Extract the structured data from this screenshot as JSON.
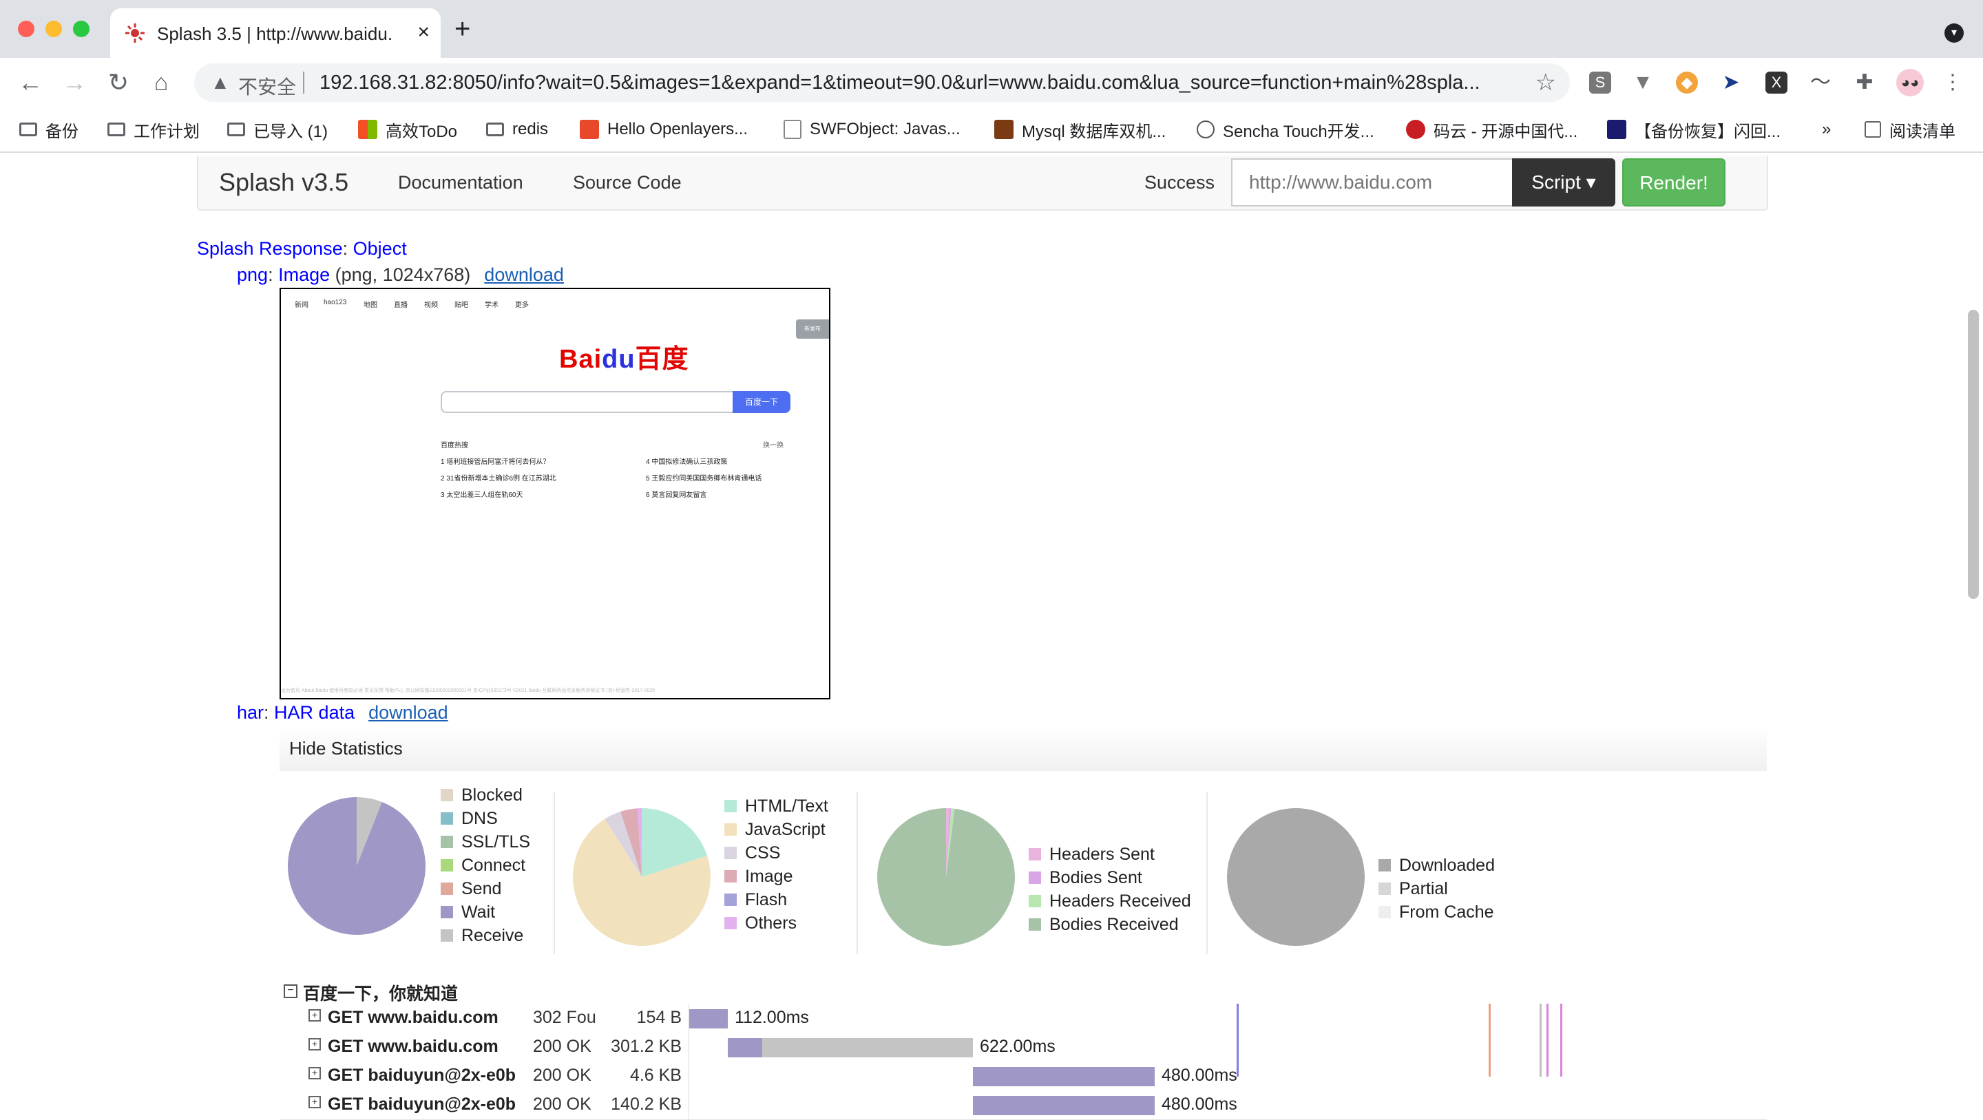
{
  "browser": {
    "tab_title": "Splash 3.5 | http://www.baidu.c",
    "tab_close": "×",
    "new_tab": "+",
    "insecure_label": "不安全",
    "url": "192.168.31.82:8050/info?wait=0.5&images=1&expand=1&timeout=90.0&url=www.baidu.com&lua_source=function+main%28spla...",
    "bookmarks": [
      "备份",
      "工作计划",
      "已导入 (1)",
      "高效ToDo",
      "redis",
      "Hello Openlayers...",
      "SWFObject: Javas...",
      "Mysql 数据库双机...",
      "Sencha Touch开发...",
      "码云 - 开源中国代...",
      "【备份恢复】闪回...",
      "»",
      "阅读清单"
    ]
  },
  "splash": {
    "brand": "Splash v3.5",
    "nav": [
      "Documentation",
      "Source Code"
    ],
    "status": "Success",
    "url_input": "http://www.baidu.com",
    "script_label": "Script ▾",
    "render_label": "Render!"
  },
  "response": {
    "root_key": "Splash Response",
    "root_type": "Object",
    "png_key": "png",
    "png_type": "Image",
    "png_info": "(png, 1024x768)",
    "png_download": "download",
    "har_key": "har",
    "har_type": "HAR data",
    "har_download": "download"
  },
  "preview": {
    "nav": [
      "新闻",
      "hao123",
      "地图",
      "直播",
      "视频",
      "贴吧",
      "学术",
      "更多"
    ],
    "logo_a": "Bai",
    "logo_b": "du",
    "logo_c": "百度",
    "search_btn": "百度一下",
    "hot_title": "百度热搜",
    "hot_refresh": "换一换",
    "hot_left": [
      "1  塔利班接管后阿富汗将何去何从？",
      "2  31省份新增本土确诊6例 在江苏湖北",
      "3  太空出差三人组在轨60天"
    ],
    "hot_right": [
      "4  中国拟修法确认三孩政策",
      "5  王毅应约同美国国务卿布林肯通电话",
      "6  莫言回复网友留言"
    ],
    "login": "新发布",
    "footer": "设为首页    About Baidu    使用百度前必读    意见反馈    帮助中心    京公网安备11000002000001号    京ICP证030173号    ©2021 Baidu    互联网药品信息服务资格证书 (京)-经营性-2017-0020"
  },
  "har": {
    "toggle_label": "Hide Statistics",
    "legend_timing": [
      {
        "label": "Blocked",
        "color": "#e2d6c4"
      },
      {
        "label": "DNS",
        "color": "#85bec8"
      },
      {
        "label": "SSL/TLS",
        "color": "#a7c3a7"
      },
      {
        "label": "Connect",
        "color": "#a9d97a"
      },
      {
        "label": "Send",
        "color": "#e0a89a"
      },
      {
        "label": "Wait",
        "color": "#9f97c5"
      },
      {
        "label": "Receive",
        "color": "#c4c4c4"
      }
    ],
    "legend_type": [
      {
        "label": "HTML/Text",
        "color": "#b5e9d8"
      },
      {
        "label": "JavaScript",
        "color": "#f1e2bd"
      },
      {
        "label": "CSS",
        "color": "#dad4e1"
      },
      {
        "label": "Image",
        "color": "#dcabb4"
      },
      {
        "label": "Flash",
        "color": "#a5a2da"
      },
      {
        "label": "Others",
        "color": "#e3b2ee"
      }
    ],
    "legend_traffic": [
      {
        "label": "Headers Sent",
        "color": "#e8b3dc"
      },
      {
        "label": "Bodies Sent",
        "color": "#d8a6e6"
      },
      {
        "label": "Headers Received",
        "color": "#b7e6b1"
      },
      {
        "label": "Bodies Received",
        "color": "#a7c3a7"
      }
    ],
    "legend_cache": [
      {
        "label": "Downloaded",
        "color": "#a9a9a9"
      },
      {
        "label": "Partial",
        "color": "#d7d7d7"
      },
      {
        "label": "From Cache",
        "color": "#eeeeee"
      }
    ],
    "pie_timing": [
      0.94,
      0.06
    ],
    "pie_type": [
      {
        "v": 0.2,
        "c": "#b5e9d8"
      },
      {
        "v": 0.71,
        "c": "#f1e2bd"
      },
      {
        "v": 0.04,
        "c": "#dad4e1"
      },
      {
        "v": 0.04,
        "c": "#dcabb4"
      },
      {
        "v": 0.01,
        "c": "#e3b2ee"
      }
    ],
    "pie_traffic": [
      {
        "v": 0.008,
        "c": "#e8b3dc"
      },
      {
        "v": 0.004,
        "c": "#d8a6e6"
      },
      {
        "v": 0.008,
        "c": "#b7e6b1"
      },
      {
        "v": 0.98,
        "c": "#a7c3a7"
      }
    ],
    "page_title": "百度一下，你就知道",
    "requests": [
      {
        "name": "GET www.baidu.com",
        "status": "302 Fou",
        "size": "154 B",
        "time": "112.00ms",
        "wait_start": 0,
        "wait_len": 56,
        "recv_len": 0
      },
      {
        "name": "GET www.baidu.com",
        "status": "200 OK",
        "size": "301.2 KB",
        "time": "622.00ms",
        "wait_start": 56,
        "wait_len": 50,
        "recv_len": 306
      },
      {
        "name": "GET baiduyun@2x-e0b",
        "status": "200 OK",
        "size": "4.6 KB",
        "time": "480.00ms",
        "wait_start": 412,
        "wait_len": 264,
        "recv_len": 0
      },
      {
        "name": "GET baiduyun@2x-e0b",
        "status": "200 OK",
        "size": "140.2 KB",
        "time": "480.00ms",
        "wait_start": 412,
        "wait_len": 264,
        "recv_len": 0
      }
    ]
  }
}
